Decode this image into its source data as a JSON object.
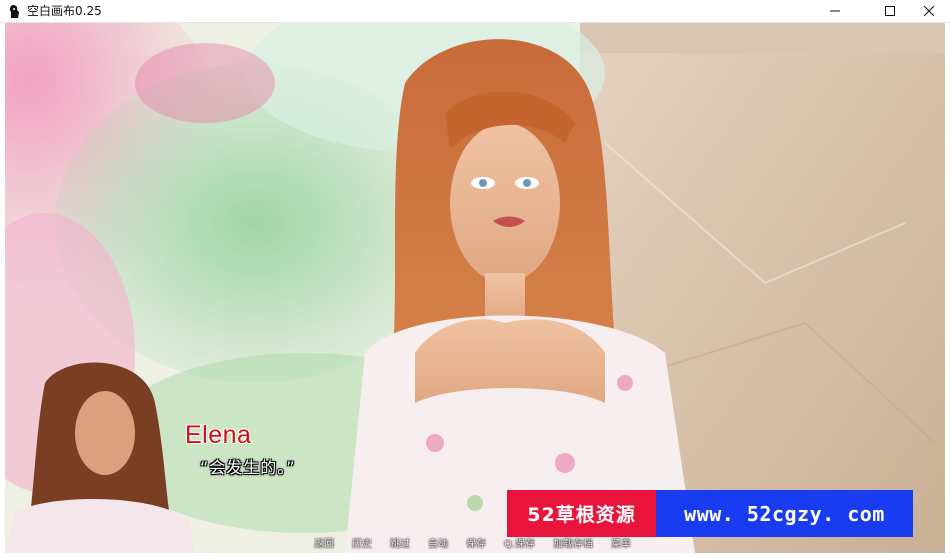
{
  "window": {
    "title": "空白画布0.25",
    "controls": {
      "minimize_icon": "minimize-icon",
      "maximize_icon": "maximize-icon",
      "close_icon": "close-icon"
    }
  },
  "dialogue": {
    "speaker": "Elena",
    "speaker_color": "#d11010",
    "line": "“会发生的。”"
  },
  "watermark": {
    "left_text": "52草根资源",
    "right_text": "www. 52cgzy. com",
    "left_color": "#e8143c",
    "right_color": "#1a3cf0"
  },
  "quick_menu": {
    "items": [
      "返回",
      "历史",
      "跳过",
      "自动",
      "保存",
      "Q.保存",
      "加载存档",
      "菜单"
    ]
  }
}
